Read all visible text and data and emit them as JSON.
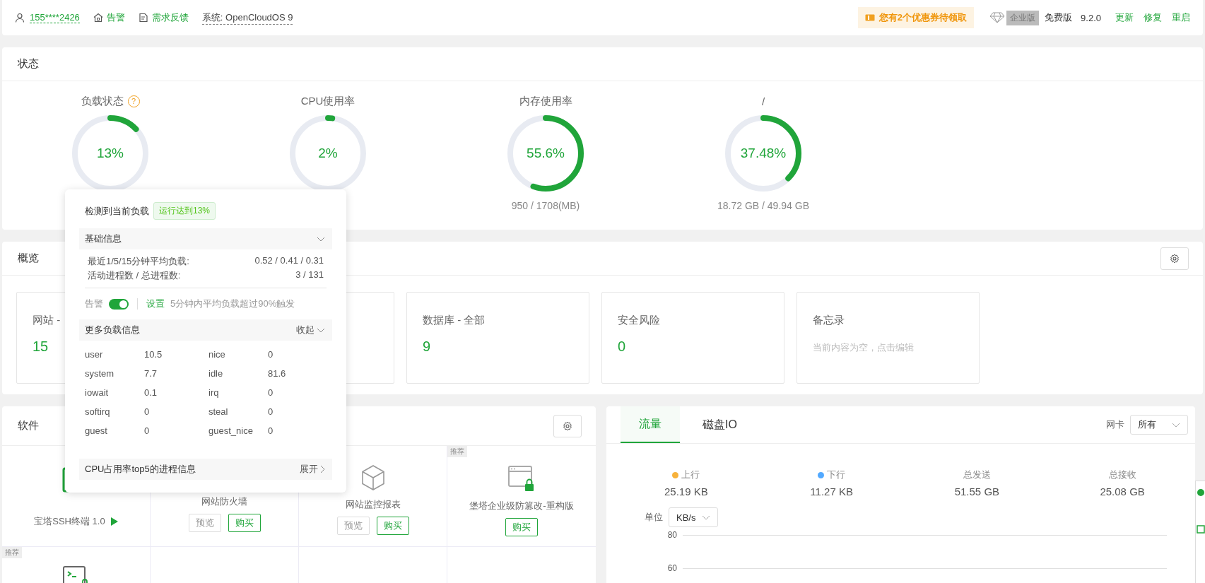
{
  "top_bar": {
    "user": "155****2426",
    "links": [
      "告警",
      "需求反馈"
    ],
    "system": "系统: OpenCloudOS 9",
    "coupon": "您有2个优惠券待领取",
    "edition_badge": "企业版",
    "edition": "免费版",
    "version": "9.2.0",
    "actions": [
      "更新",
      "修复",
      "重启"
    ]
  },
  "status": {
    "title": "状态",
    "gauges": [
      {
        "label": "负载状态",
        "help": "?",
        "level": 0.13,
        "value": "13%"
      },
      {
        "label": "CPU使用率",
        "level": 0.02,
        "value": "2%"
      },
      {
        "label": "内存使用率",
        "level": 0.556,
        "value": "55.6%",
        "detail": "950 / 1708(MB)"
      },
      {
        "label": "/",
        "level": 0.3748,
        "value": "37.48%",
        "detail": "18.72 GB / 49.94 GB"
      }
    ]
  },
  "overview": {
    "title": "概览",
    "cards": [
      {
        "kind": "stat",
        "title": "网站 -",
        "value": "15"
      },
      {
        "kind": "covered"
      },
      {
        "kind": "stat",
        "title": "数据库 - 全部",
        "value": "9"
      },
      {
        "kind": "stat",
        "title": "安全风险",
        "value": "0"
      },
      {
        "kind": "note",
        "title": "备忘录",
        "placeholder": "当前内容为空，点击编辑"
      }
    ]
  },
  "software": {
    "title": "软件",
    "items": [
      {
        "kind": "installed",
        "name": "宝塔SSH终端 1.0"
      },
      {
        "kind": "store",
        "name": "网站防火墙",
        "buttons": [
          {
            "label": "预览",
            "primary": false
          },
          {
            "label": "购买",
            "primary": true
          }
        ]
      },
      {
        "kind": "store",
        "name": "网站监控报表",
        "buttons": [
          {
            "label": "预览",
            "primary": false
          },
          {
            "label": "购买",
            "primary": true
          }
        ]
      },
      {
        "kind": "store",
        "name": "堡塔企业级防篡改-重构版",
        "tag": "推荐",
        "buttons": [
          {
            "label": "购买",
            "primary": true
          }
        ]
      },
      {
        "kind": "store",
        "tag": "推荐"
      }
    ]
  },
  "traffic": {
    "tabs": [
      {
        "label": "流量",
        "selected": true
      },
      {
        "label": "磁盘IO",
        "selected": false
      }
    ],
    "nic_label": "网卡",
    "nic_value": "所有",
    "stats": [
      {
        "label": "上行",
        "color": "#f7b23b",
        "value": "25.19 KB"
      },
      {
        "label": "下行",
        "color": "#52a9ff",
        "value": "11.27 KB"
      },
      {
        "label": "总发送",
        "value": "51.55 GB"
      },
      {
        "label": "总接收",
        "value": "25.08 GB"
      }
    ],
    "unit_label": "单位",
    "unit_value": "KB/s",
    "y_ticks": [
      "80",
      "60"
    ]
  },
  "load_popup": {
    "heading": "检测到当前负载",
    "badge": "运行达到13%",
    "basic": {
      "title": "基础信息",
      "rows": [
        {
          "label": "最近1/5/15分钟平均负载:",
          "value": "0.52 / 0.41 / 0.31"
        },
        {
          "label": "活动进程数 / 总进程数:",
          "value": "3 / 131"
        }
      ]
    },
    "alarm": {
      "label": "告警",
      "on": true,
      "link": "设置",
      "note": "5分钟内平均负载超过90%触发"
    },
    "more": {
      "title": "更多负载信息",
      "toggle": "收起",
      "metrics": [
        {
          "name": "user",
          "value": "10.5"
        },
        {
          "name": "nice",
          "value": "0"
        },
        {
          "name": "system",
          "value": "7.7"
        },
        {
          "name": "idle",
          "value": "81.6"
        },
        {
          "name": "iowait",
          "value": "0.1"
        },
        {
          "name": "irq",
          "value": "0"
        },
        {
          "name": "softirq",
          "value": "0"
        },
        {
          "name": "steal",
          "value": "0"
        },
        {
          "name": "guest",
          "value": "0"
        },
        {
          "name": "guest_nice",
          "value": "0"
        }
      ]
    },
    "top5": {
      "title": "CPU占用率top5的进程信息",
      "toggle": "展开"
    }
  }
}
